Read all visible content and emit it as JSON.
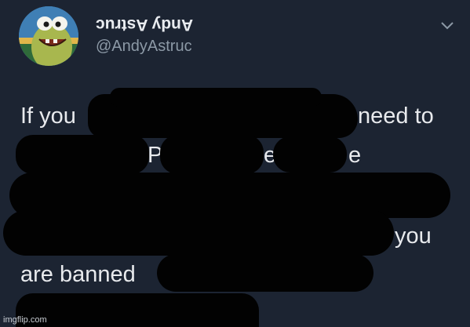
{
  "header": {
    "display_name": "Andy Astruc",
    "handle": "@AndyAstruc",
    "menu_icon": "chevron-down-icon",
    "avatar_icon": "cartoon-fish-avatar"
  },
  "tweet": {
    "fragments": [
      "If you",
      "need to",
      "P",
      "e",
      "e",
      "you",
      "are banned"
    ]
  },
  "watermark": "imgflip.com",
  "colors": {
    "background": "#1c2432",
    "text": "#e8eaed",
    "secondary": "#8c99a6",
    "redaction": "#020202"
  }
}
